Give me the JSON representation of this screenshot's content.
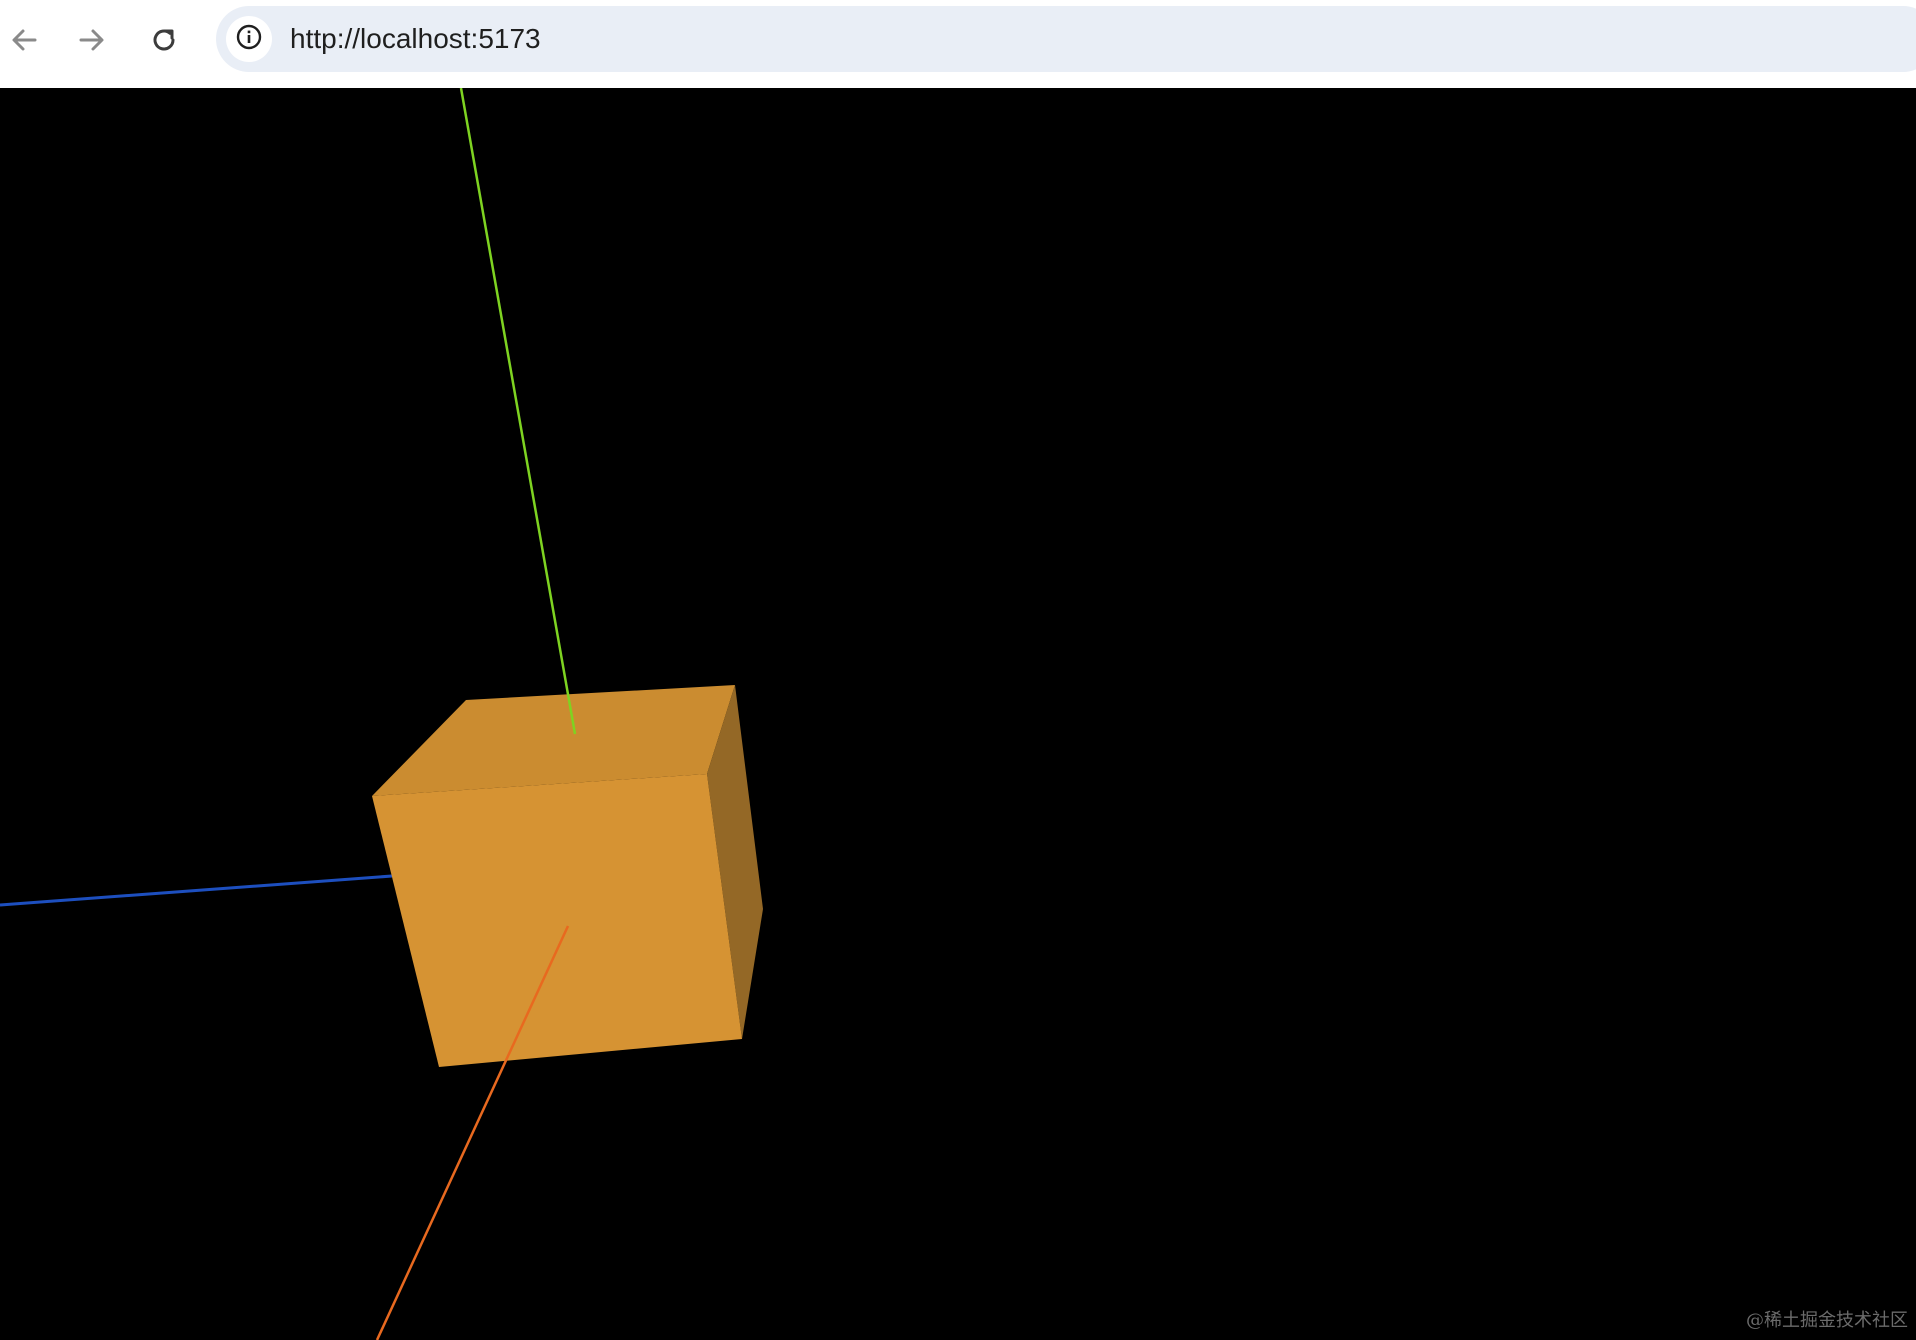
{
  "browser": {
    "url": "http://localhost:5173",
    "icons": {
      "back": "arrow-left-icon",
      "forward": "arrow-right-icon",
      "reload": "reload-icon",
      "site_info": "info-circle-icon"
    }
  },
  "scene": {
    "background": "#000000",
    "axes_colors": {
      "x_axis": "#e8691f",
      "y_axis": "#7ed321",
      "z_axis": "#1d4fbf"
    },
    "cube_colors": {
      "front": "#d69333",
      "top": "#cb8c30",
      "right": "#946826"
    }
  },
  "watermark": {
    "text": "@稀土掘金技术社区"
  }
}
